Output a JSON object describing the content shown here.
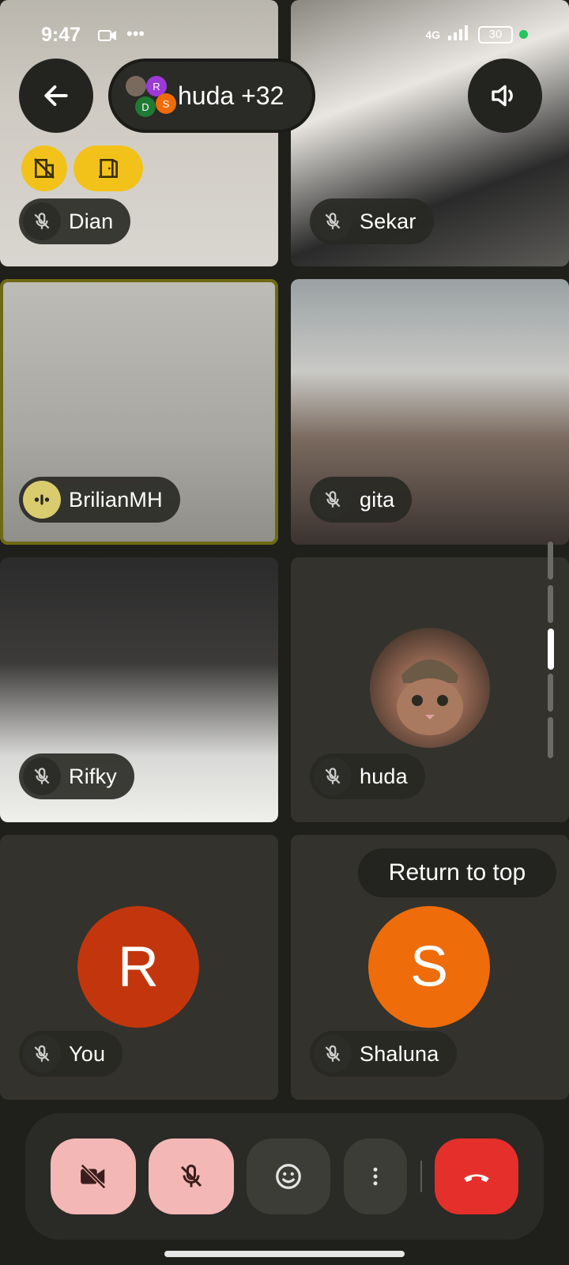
{
  "status_bar": {
    "time": "9:47",
    "network": "4G",
    "battery": "30"
  },
  "header": {
    "meeting_title": "huda +32",
    "mini_avatars": [
      "R",
      "D",
      "S"
    ]
  },
  "tiles": [
    {
      "name": "Dian"
    },
    {
      "name": "Sekar"
    },
    {
      "name": "BrilianMH"
    },
    {
      "name": "gita"
    },
    {
      "name": "Rifky"
    },
    {
      "name": "huda"
    },
    {
      "name": "You",
      "avatar_letter": "R"
    },
    {
      "name": "Shaluna",
      "avatar_letter": "S"
    }
  ],
  "return_to_top": "Return to top",
  "colors": {
    "accent_yellow": "#f2c21b",
    "avatar_r": "#c3360d",
    "avatar_s": "#ee6c0a",
    "end_call": "#e52f2b",
    "muted_pink": "#f3b8b5"
  }
}
